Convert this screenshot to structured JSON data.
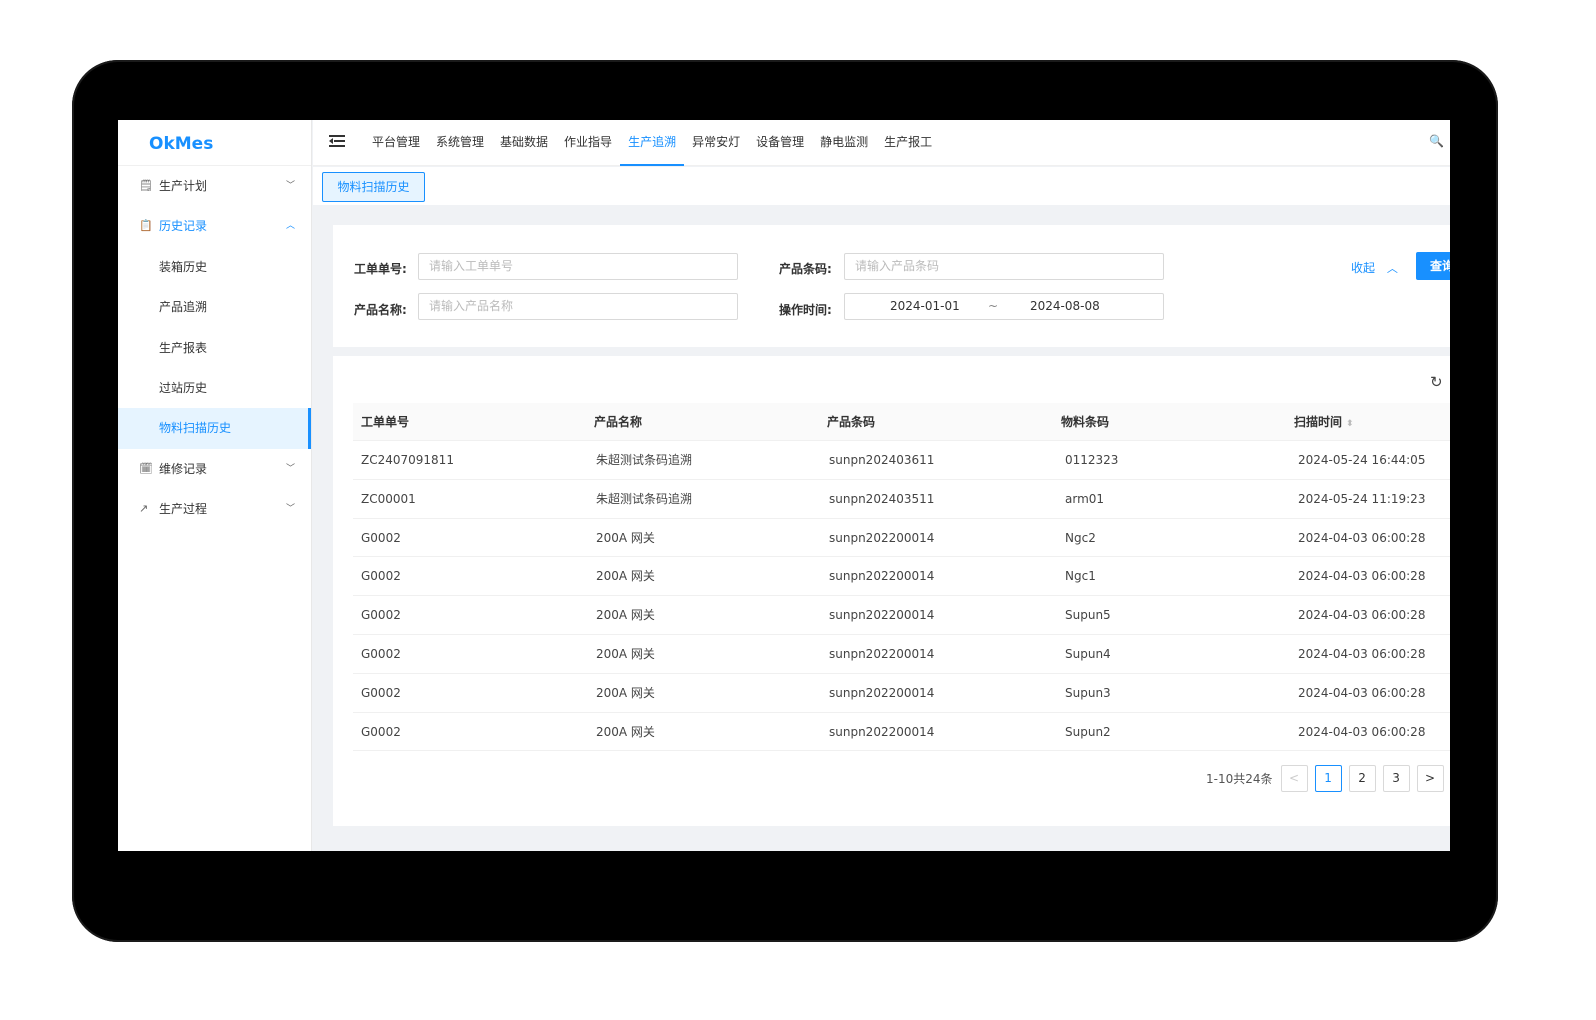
{
  "app": {
    "logo": "OkMes"
  },
  "sidebar": {
    "items": [
      {
        "icon": "clipboard-icon",
        "glyph": "🗒",
        "label": "生产计划",
        "open": false
      },
      {
        "icon": "history-icon",
        "glyph": "📋",
        "label": "历史记录",
        "open": true,
        "children": [
          "装箱历史",
          "产品追溯",
          "生产报表",
          "过站历史",
          "物料扫描历史"
        ]
      },
      {
        "icon": "repair-icon",
        "glyph": "🗓",
        "label": "维修记录",
        "open": false
      },
      {
        "icon": "trend-icon",
        "glyph": "↗",
        "label": "生产过程",
        "open": false
      }
    ],
    "active_child": "物料扫描历史"
  },
  "topnav": {
    "items": [
      "平台管理",
      "系统管理",
      "基础数据",
      "作业指导",
      "生产追溯",
      "异常安灯",
      "设备管理",
      "静电监测",
      "生产报工"
    ],
    "active": "生产追溯"
  },
  "tags": {
    "current": "物料扫描历史"
  },
  "search": {
    "order_label": "工单单号:",
    "order_placeholder": "请输入工单单号",
    "barcode_label": "产品条码:",
    "barcode_placeholder": "请输入产品条码",
    "name_label": "产品名称:",
    "name_placeholder": "请输入产品名称",
    "time_label": "操作时间:",
    "time_start": "2024-01-01",
    "time_sep": "~",
    "time_end": "2024-08-08",
    "collapse_label": "收起",
    "query_label": "查询"
  },
  "table": {
    "columns": [
      "工单单号",
      "产品名称",
      "产品条码",
      "物料条码",
      "扫描时间"
    ],
    "rows": [
      [
        "ZC2407091811",
        "朱超测试条码追溯",
        "sunpn202403611",
        "0112323",
        "2024-05-24 16:44:05"
      ],
      [
        "ZC00001",
        "朱超测试条码追溯",
        "sunpn202403511",
        "arm01",
        "2024-05-24 11:19:23"
      ],
      [
        "G0002",
        "200A 网关",
        "sunpn202200014",
        "Ngc2",
        "2024-04-03 06:00:28"
      ],
      [
        "G0002",
        "200A 网关",
        "sunpn202200014",
        "Ngc1",
        "2024-04-03 06:00:28"
      ],
      [
        "G0002",
        "200A 网关",
        "sunpn202200014",
        "Supun5",
        "2024-04-03 06:00:28"
      ],
      [
        "G0002",
        "200A 网关",
        "sunpn202200014",
        "Supun4",
        "2024-04-03 06:00:28"
      ],
      [
        "G0002",
        "200A 网关",
        "sunpn202200014",
        "Supun3",
        "2024-04-03 06:00:28"
      ],
      [
        "G0002",
        "200A 网关",
        "sunpn202200014",
        "Supun2",
        "2024-04-03 06:00:28"
      ]
    ]
  },
  "pagination": {
    "total_text": "1-10共24条",
    "pages": [
      "1",
      "2",
      "3"
    ],
    "current": "1",
    "prev": "<",
    "next": ">"
  },
  "colors": {
    "accent": "#1890ff",
    "bg": "#f0f2f5"
  }
}
